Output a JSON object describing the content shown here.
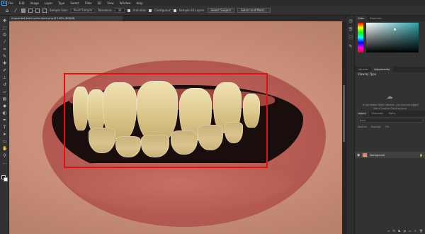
{
  "app": {
    "logo": "Ps"
  },
  "menu": [
    "File",
    "Edit",
    "Image",
    "Layer",
    "Type",
    "Select",
    "Filter",
    "3D",
    "View",
    "Window",
    "Help"
  ],
  "options_bar": {
    "sample_size_label": "Sample Size:",
    "sample_size_value": "Point Sample",
    "tolerance_label": "Tolerance:",
    "tolerance_value": "32",
    "anti_alias_label": "Anti-alias",
    "contiguous_label": "Contiguous",
    "sample_all_layers_label": "Sample All Layers",
    "select_subject_label": "Select Subject",
    "select_and_mask_label": "Select and Mask..."
  },
  "document": {
    "tab_title": "Unguarded-teeth-smile-stock.png @ 100% (RGB/8)",
    "annotation_color": "#e01111"
  },
  "panels": {
    "color_tabs": [
      "Color",
      "Swatches"
    ],
    "properties_tabs": [
      "Libraries",
      "Adjustments"
    ],
    "generate_title": "View by Type",
    "generate_message": "To use Adobe Stock Libraries, you must be logged into a Creative Cloud account.",
    "layers_tabs": [
      "Layers",
      "Channels",
      "Paths"
    ],
    "layers_search_placeholder": "Kind",
    "layer_blend_mode": "Normal",
    "layer_opacity_label": "Opacity:",
    "layer_fill_label": "Fill:",
    "layer_name": "Background"
  },
  "icons": {
    "toolbar": [
      "move-tool-icon",
      "marquee-tool-icon",
      "lasso-tool-icon",
      "magic-wand-tool-icon",
      "crop-tool-icon",
      "eyedropper-tool-icon",
      "healing-brush-icon",
      "brush-tool-icon",
      "clone-stamp-icon",
      "history-brush-icon",
      "eraser-tool-icon",
      "gradient-tool-icon",
      "blur-tool-icon",
      "dodge-tool-icon",
      "pen-tool-icon",
      "type-tool-icon",
      "path-selection-icon",
      "rectangle-tool-icon",
      "hand-tool-icon",
      "zoom-tool-icon"
    ],
    "strip": [
      "history-icon",
      "properties-icon",
      "info-icon",
      "brushes-icon"
    ]
  }
}
